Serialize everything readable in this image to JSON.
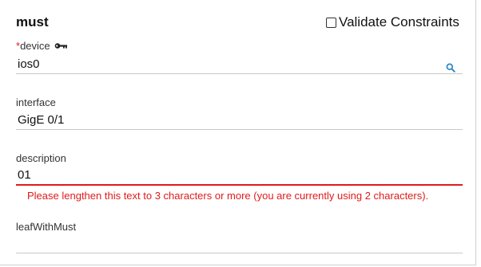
{
  "form": {
    "title": "must",
    "validate_label": "Validate Constraints",
    "validate_checked": false
  },
  "fields": {
    "device": {
      "required_mark": "*",
      "label": "device",
      "value": "ios0",
      "key_icon": "key-icon",
      "search_icon": "search-icon"
    },
    "interface": {
      "label": "interface",
      "value": "GigE 0/1"
    },
    "description": {
      "label": "description",
      "value": "01",
      "error": "Please lengthen this text to 3 characters or more (you are currently using 2 characters)."
    },
    "leafWithMust": {
      "label": "leafWithMust",
      "value": ""
    }
  },
  "colors": {
    "error": "#e01b1b",
    "required": "#e01b1b",
    "search_icon": "#2a86c8",
    "underline": "#c8c8c8"
  }
}
